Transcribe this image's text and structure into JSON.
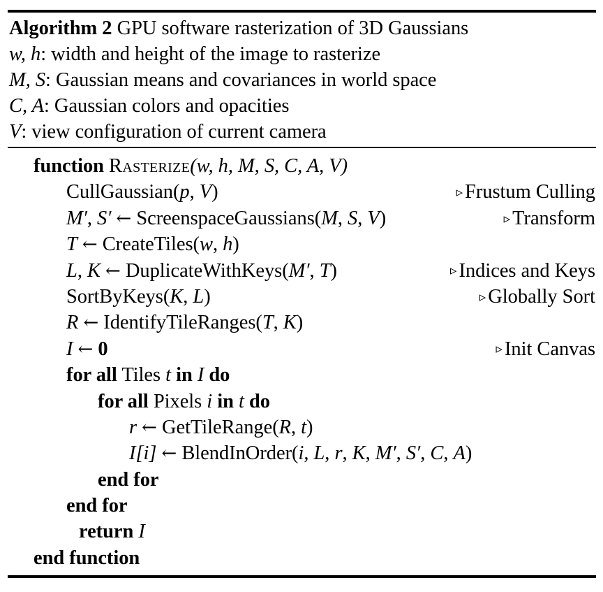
{
  "figure": {
    "kind": "algorithm-pseudocode",
    "label": "Algorithm 2",
    "title": "GPU software rasterization of 3D Gaussians",
    "rules": {
      "top": "thick",
      "middle": "thin",
      "bottom": "thick"
    }
  },
  "inputs": [
    {
      "symbols": "w, h",
      "description": ": width and height of the image to rasterize"
    },
    {
      "symbols": "M, S",
      "description": ": Gaussian means and covariances in world space"
    },
    {
      "symbols": "C, A",
      "description": ": Gaussian colors and opacities"
    },
    {
      "symbols": "V",
      "description": ": view configuration of current camera"
    }
  ],
  "body": [
    {
      "id": "l01",
      "indent": 0,
      "keyword": "function",
      "name": "Rasterize",
      "args": "(w, h, M, S, C, A, V)",
      "comment": ""
    },
    {
      "id": "l02",
      "indent": 1,
      "code": "CullGaussian(p, V)",
      "comment": "Frustum Culling"
    },
    {
      "id": "l03",
      "indent": 1,
      "code": "M′, S′ ← ScreenspaceGaussians(M, S, V)",
      "comment": "Transform"
    },
    {
      "id": "l04",
      "indent": 1,
      "code": "T ← CreateTiles(w, h)",
      "comment": ""
    },
    {
      "id": "l05",
      "indent": 1,
      "code": "L, K ← DuplicateWithKeys(M′, T)",
      "comment": "Indices and Keys"
    },
    {
      "id": "l06",
      "indent": 1,
      "code": "SortByKeys(K, L)",
      "comment": "Globally Sort"
    },
    {
      "id": "l07",
      "indent": 1,
      "code": "R ← IdentifyTileRanges(T, K)",
      "comment": ""
    },
    {
      "id": "l08",
      "indent": 1,
      "code": "I ← 0",
      "comment": "Init Canvas"
    },
    {
      "id": "l09",
      "indent": 1,
      "code": "for all Tiles t in I do",
      "comment": ""
    },
    {
      "id": "l10",
      "indent": 2,
      "code": "for all Pixels i in t do",
      "comment": ""
    },
    {
      "id": "l11",
      "indent": 3,
      "code": "r ← GetTileRange(R, t)",
      "comment": ""
    },
    {
      "id": "l12",
      "indent": 3,
      "code": "I[i] ← BlendInOrder(i, L, r, K, M′, S′, C, A)",
      "comment": ""
    },
    {
      "id": "l13",
      "indent": 2,
      "code": "end for",
      "comment": ""
    },
    {
      "id": "l14",
      "indent": 1,
      "code": "end for",
      "comment": ""
    },
    {
      "id": "l15",
      "indent": 1,
      "code": "return I",
      "comment": ""
    },
    {
      "id": "l16",
      "indent": 0,
      "code": "end function",
      "comment": ""
    }
  ],
  "tokens": {
    "function_kw": "function",
    "proc_name": "Rasterize",
    "proc_args": "(w, h, M, S, C, A, V)",
    "for_all": "for all",
    "in_kw": "in",
    "do_kw": "do",
    "end_for": "end for",
    "end_function": "end function",
    "return_kw": "return",
    "arrow": "←",
    "triangle": "▹",
    "zero": "0",
    "prime": "′"
  },
  "line_texts": {
    "cullgaussian_call": "CullGaussian(",
    "cullgaussian_args_p": "p",
    "comma_space": ", ",
    "screenspace_call": "ScreenspaceGaussians(",
    "createtiles_call": "CreateTiles(",
    "duplicate_call": "DuplicateWithKeys(",
    "sortbykeys_call": "SortByKeys(",
    "identify_call": "IdentifyTileRanges(",
    "gettilerange_call": "GetTileRange(",
    "blendinorder_call": "BlendInOrder(",
    "tiles_word": "Tiles",
    "pixels_word": "Pixels"
  },
  "vars": {
    "w": "w",
    "h": "h",
    "M": "M",
    "S": "S",
    "C": "C",
    "A": "A",
    "V": "V",
    "T": "T",
    "L": "L",
    "K": "K",
    "R": "R",
    "I": "I",
    "t": "t",
    "i": "i",
    "r": "r",
    "p": "p"
  },
  "comments": {
    "frustum": "Frustum Culling",
    "transform": "Transform",
    "indices": "Indices and Keys",
    "globally": "Globally Sort",
    "init": "Init Canvas"
  },
  "colors": {
    "text": "#000000",
    "background": "#ffffff",
    "rule": "#000000"
  }
}
